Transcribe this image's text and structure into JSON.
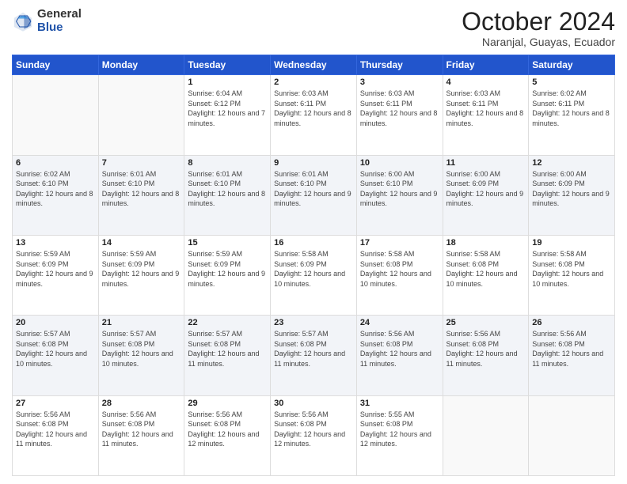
{
  "header": {
    "logo_general": "General",
    "logo_blue": "Blue",
    "title": "October 2024",
    "location": "Naranjal, Guayas, Ecuador"
  },
  "days_of_week": [
    "Sunday",
    "Monday",
    "Tuesday",
    "Wednesday",
    "Thursday",
    "Friday",
    "Saturday"
  ],
  "weeks": [
    [
      {
        "day": "",
        "sunrise": "",
        "sunset": "",
        "daylight": ""
      },
      {
        "day": "",
        "sunrise": "",
        "sunset": "",
        "daylight": ""
      },
      {
        "day": "1",
        "sunrise": "Sunrise: 6:04 AM",
        "sunset": "Sunset: 6:12 PM",
        "daylight": "Daylight: 12 hours and 7 minutes."
      },
      {
        "day": "2",
        "sunrise": "Sunrise: 6:03 AM",
        "sunset": "Sunset: 6:11 PM",
        "daylight": "Daylight: 12 hours and 8 minutes."
      },
      {
        "day": "3",
        "sunrise": "Sunrise: 6:03 AM",
        "sunset": "Sunset: 6:11 PM",
        "daylight": "Daylight: 12 hours and 8 minutes."
      },
      {
        "day": "4",
        "sunrise": "Sunrise: 6:03 AM",
        "sunset": "Sunset: 6:11 PM",
        "daylight": "Daylight: 12 hours and 8 minutes."
      },
      {
        "day": "5",
        "sunrise": "Sunrise: 6:02 AM",
        "sunset": "Sunset: 6:11 PM",
        "daylight": "Daylight: 12 hours and 8 minutes."
      }
    ],
    [
      {
        "day": "6",
        "sunrise": "Sunrise: 6:02 AM",
        "sunset": "Sunset: 6:10 PM",
        "daylight": "Daylight: 12 hours and 8 minutes."
      },
      {
        "day": "7",
        "sunrise": "Sunrise: 6:01 AM",
        "sunset": "Sunset: 6:10 PM",
        "daylight": "Daylight: 12 hours and 8 minutes."
      },
      {
        "day": "8",
        "sunrise": "Sunrise: 6:01 AM",
        "sunset": "Sunset: 6:10 PM",
        "daylight": "Daylight: 12 hours and 8 minutes."
      },
      {
        "day": "9",
        "sunrise": "Sunrise: 6:01 AM",
        "sunset": "Sunset: 6:10 PM",
        "daylight": "Daylight: 12 hours and 9 minutes."
      },
      {
        "day": "10",
        "sunrise": "Sunrise: 6:00 AM",
        "sunset": "Sunset: 6:10 PM",
        "daylight": "Daylight: 12 hours and 9 minutes."
      },
      {
        "day": "11",
        "sunrise": "Sunrise: 6:00 AM",
        "sunset": "Sunset: 6:09 PM",
        "daylight": "Daylight: 12 hours and 9 minutes."
      },
      {
        "day": "12",
        "sunrise": "Sunrise: 6:00 AM",
        "sunset": "Sunset: 6:09 PM",
        "daylight": "Daylight: 12 hours and 9 minutes."
      }
    ],
    [
      {
        "day": "13",
        "sunrise": "Sunrise: 5:59 AM",
        "sunset": "Sunset: 6:09 PM",
        "daylight": "Daylight: 12 hours and 9 minutes."
      },
      {
        "day": "14",
        "sunrise": "Sunrise: 5:59 AM",
        "sunset": "Sunset: 6:09 PM",
        "daylight": "Daylight: 12 hours and 9 minutes."
      },
      {
        "day": "15",
        "sunrise": "Sunrise: 5:59 AM",
        "sunset": "Sunset: 6:09 PM",
        "daylight": "Daylight: 12 hours and 9 minutes."
      },
      {
        "day": "16",
        "sunrise": "Sunrise: 5:58 AM",
        "sunset": "Sunset: 6:09 PM",
        "daylight": "Daylight: 12 hours and 10 minutes."
      },
      {
        "day": "17",
        "sunrise": "Sunrise: 5:58 AM",
        "sunset": "Sunset: 6:08 PM",
        "daylight": "Daylight: 12 hours and 10 minutes."
      },
      {
        "day": "18",
        "sunrise": "Sunrise: 5:58 AM",
        "sunset": "Sunset: 6:08 PM",
        "daylight": "Daylight: 12 hours and 10 minutes."
      },
      {
        "day": "19",
        "sunrise": "Sunrise: 5:58 AM",
        "sunset": "Sunset: 6:08 PM",
        "daylight": "Daylight: 12 hours and 10 minutes."
      }
    ],
    [
      {
        "day": "20",
        "sunrise": "Sunrise: 5:57 AM",
        "sunset": "Sunset: 6:08 PM",
        "daylight": "Daylight: 12 hours and 10 minutes."
      },
      {
        "day": "21",
        "sunrise": "Sunrise: 5:57 AM",
        "sunset": "Sunset: 6:08 PM",
        "daylight": "Daylight: 12 hours and 10 minutes."
      },
      {
        "day": "22",
        "sunrise": "Sunrise: 5:57 AM",
        "sunset": "Sunset: 6:08 PM",
        "daylight": "Daylight: 12 hours and 11 minutes."
      },
      {
        "day": "23",
        "sunrise": "Sunrise: 5:57 AM",
        "sunset": "Sunset: 6:08 PM",
        "daylight": "Daylight: 12 hours and 11 minutes."
      },
      {
        "day": "24",
        "sunrise": "Sunrise: 5:56 AM",
        "sunset": "Sunset: 6:08 PM",
        "daylight": "Daylight: 12 hours and 11 minutes."
      },
      {
        "day": "25",
        "sunrise": "Sunrise: 5:56 AM",
        "sunset": "Sunset: 6:08 PM",
        "daylight": "Daylight: 12 hours and 11 minutes."
      },
      {
        "day": "26",
        "sunrise": "Sunrise: 5:56 AM",
        "sunset": "Sunset: 6:08 PM",
        "daylight": "Daylight: 12 hours and 11 minutes."
      }
    ],
    [
      {
        "day": "27",
        "sunrise": "Sunrise: 5:56 AM",
        "sunset": "Sunset: 6:08 PM",
        "daylight": "Daylight: 12 hours and 11 minutes."
      },
      {
        "day": "28",
        "sunrise": "Sunrise: 5:56 AM",
        "sunset": "Sunset: 6:08 PM",
        "daylight": "Daylight: 12 hours and 11 minutes."
      },
      {
        "day": "29",
        "sunrise": "Sunrise: 5:56 AM",
        "sunset": "Sunset: 6:08 PM",
        "daylight": "Daylight: 12 hours and 12 minutes."
      },
      {
        "day": "30",
        "sunrise": "Sunrise: 5:56 AM",
        "sunset": "Sunset: 6:08 PM",
        "daylight": "Daylight: 12 hours and 12 minutes."
      },
      {
        "day": "31",
        "sunrise": "Sunrise: 5:55 AM",
        "sunset": "Sunset: 6:08 PM",
        "daylight": "Daylight: 12 hours and 12 minutes."
      },
      {
        "day": "",
        "sunrise": "",
        "sunset": "",
        "daylight": ""
      },
      {
        "day": "",
        "sunrise": "",
        "sunset": "",
        "daylight": ""
      }
    ]
  ]
}
